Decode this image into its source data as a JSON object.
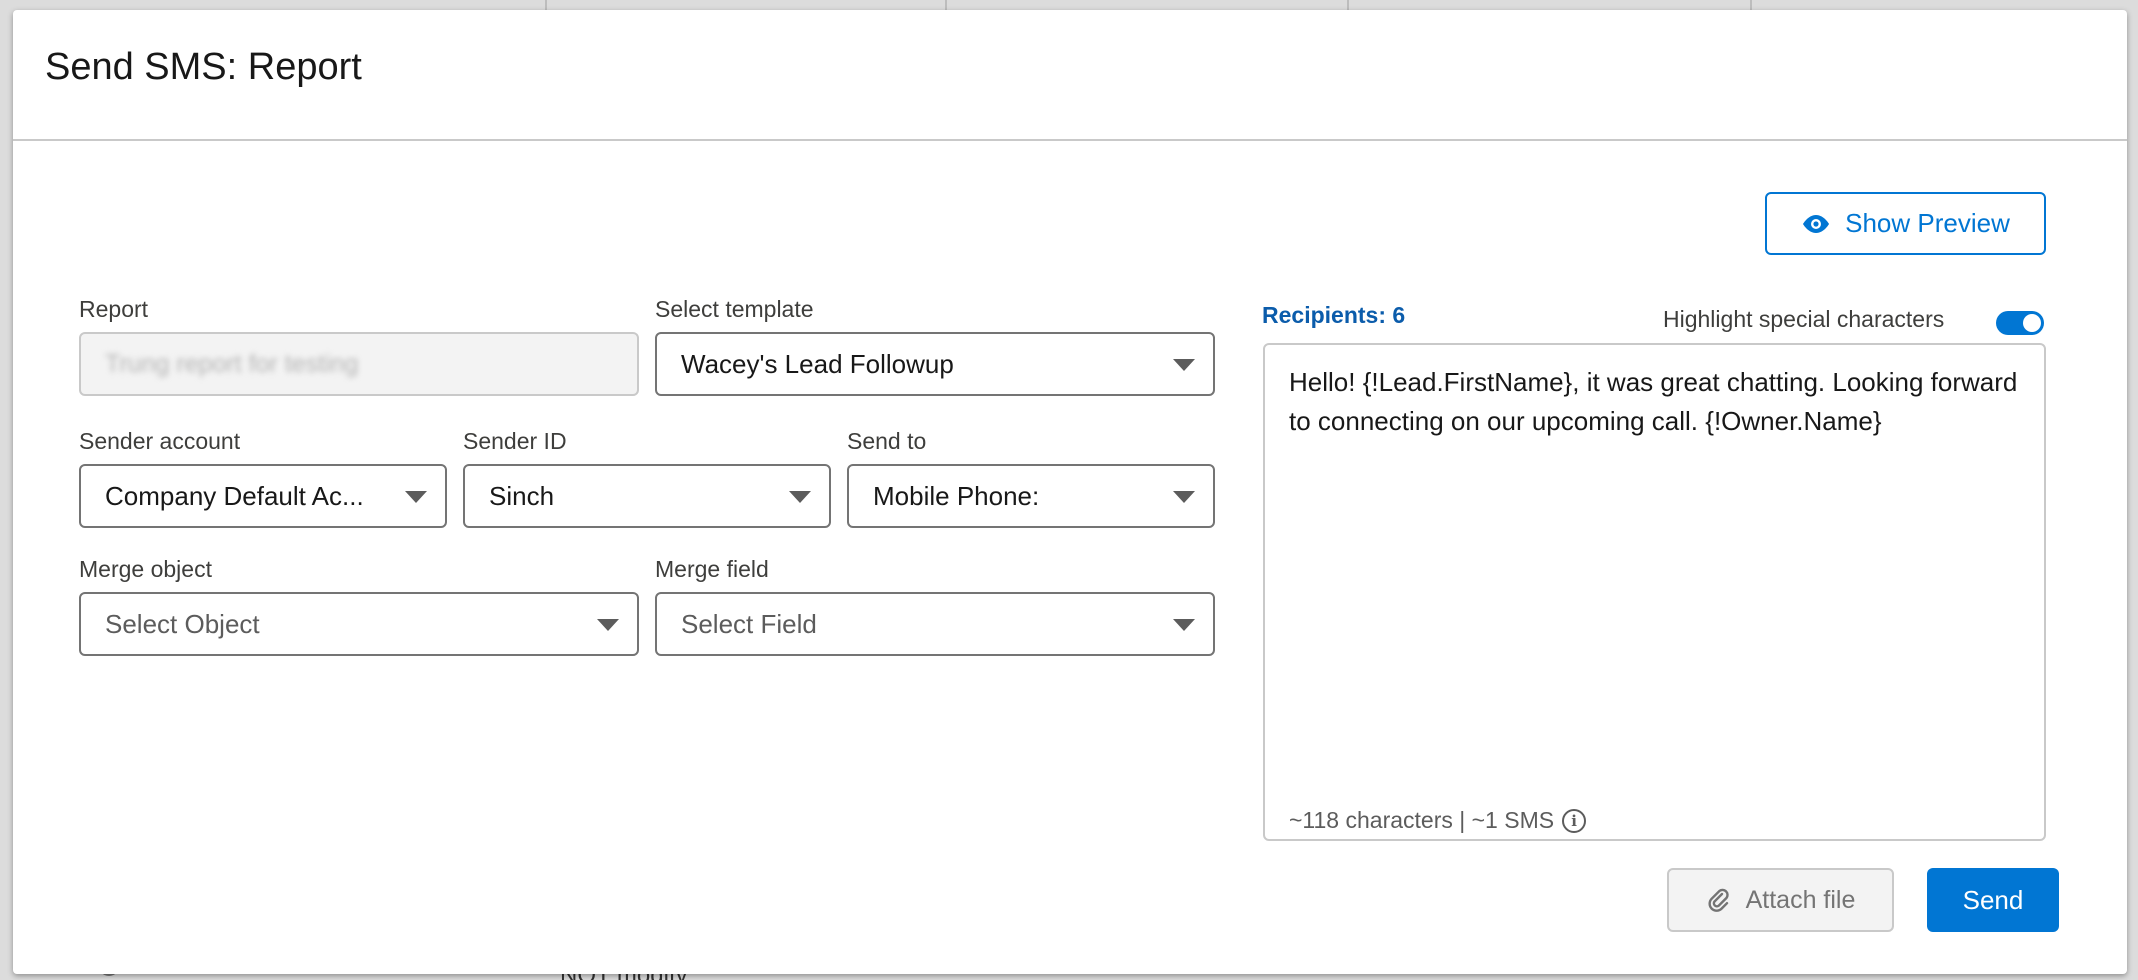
{
  "modal": {
    "title": "Send SMS: Report"
  },
  "toolbar": {
    "show_preview_label": "Show Preview",
    "preview_icon": "eye-icon"
  },
  "form": {
    "report": {
      "label": "Report",
      "value": "Trung report for testing"
    },
    "template": {
      "label": "Select template",
      "value": "Wacey's Lead Followup"
    },
    "sender_account": {
      "label": "Sender account",
      "value": "Company Default Ac..."
    },
    "sender_id": {
      "label": "Sender ID",
      "value": "Sinch"
    },
    "send_to": {
      "label": "Send to",
      "value": "Mobile Phone:"
    },
    "merge_object": {
      "label": "Merge object",
      "placeholder": "Select Object"
    },
    "merge_field": {
      "label": "Merge field",
      "placeholder": "Select Field"
    }
  },
  "message": {
    "recipients_label": "Recipients: 6",
    "highlight_label": "Highlight special characters",
    "highlight_enabled": true,
    "text": "Hello! {!Lead.FirstName}, it was great chatting. Looking forward to connecting on our upcoming call. {!Owner.Name}",
    "char_count": "~118 characters | ~1 SMS"
  },
  "actions": {
    "attach_label": "Attach file",
    "attach_icon": "paperclip-icon",
    "send_label": "Send"
  },
  "background": {
    "partial_text": "NOT modify"
  },
  "colors": {
    "brand": "#0176d3",
    "recipients": "#0b5cab"
  }
}
